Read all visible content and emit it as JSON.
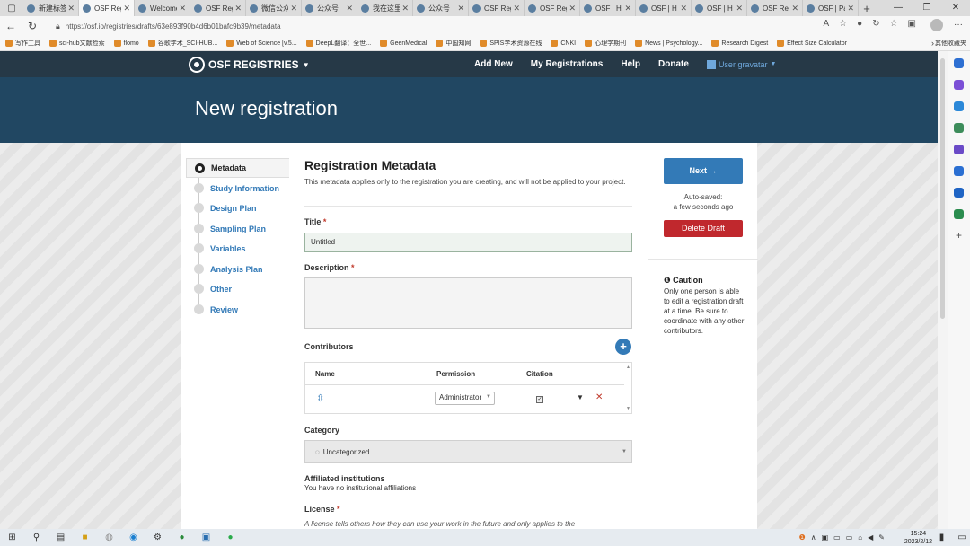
{
  "browser": {
    "tabs": [
      "新建标签",
      "OSF Reg",
      "Welcome",
      "OSF Reg",
      "微信公众",
      "公众号",
      "我在这里",
      "公众号",
      "OSF Reg",
      "OSF Reg",
      "OSF | H",
      "OSF | H",
      "OSF | H",
      "OSF Reg",
      "OSF | Pa"
    ],
    "active_tab_index": 1,
    "url": "https://osf.io/registries/drafts/63e893f90b4d6b01bafc9b39/metadata",
    "bookmarks": [
      "写作工具",
      "sci-hub文献检索",
      "flomo",
      "谷歌学术_SCI-HUB...",
      "Web of Science [v.5...",
      "DeepL翻译：全世...",
      "GeenMedical",
      "中国知网",
      "SPIS学术资源在线",
      "CNKI",
      "心理学期刊",
      "News | Psychology...",
      "Research Digest",
      "Effect Size Calculator"
    ],
    "other_bookmarks": "其他收藏夹"
  },
  "osf_nav": {
    "brand": "OSF REGISTRIES",
    "links": [
      "Add New",
      "My Registrations",
      "Help",
      "Donate"
    ],
    "user": "User gravatar"
  },
  "hero": {
    "title": "New registration"
  },
  "steps": [
    {
      "label": "Metadata",
      "active": true
    },
    {
      "label": "Study Information",
      "active": false
    },
    {
      "label": "Design Plan",
      "active": false
    },
    {
      "label": "Sampling Plan",
      "active": false
    },
    {
      "label": "Variables",
      "active": false
    },
    {
      "label": "Analysis Plan",
      "active": false
    },
    {
      "label": "Other",
      "active": false
    },
    {
      "label": "Review",
      "active": false
    }
  ],
  "form": {
    "heading": "Registration Metadata",
    "hint": "This metadata applies only to the registration you are creating, and will not be applied to your project.",
    "title_label": "Title",
    "title_value": "Untitled",
    "description_label": "Description",
    "contributors_label": "Contributors",
    "columns": [
      "Name",
      "Permission",
      "Citation"
    ],
    "contributor_permission": "Administrator",
    "category_label": "Category",
    "category_value": "Uncategorized",
    "affiliated_label": "Affiliated institutions",
    "affiliated_text": "You have no institutional affiliations",
    "license_label": "License",
    "license_text": "A license tells others how they can use your work in the future and only applies to the"
  },
  "sidebar_right": {
    "next_label": "Next →",
    "autosaved_line1": "Auto-saved:",
    "autosaved_line2": "a few seconds ago",
    "delete_label": "Delete Draft",
    "caution_title": "Caution",
    "caution_text": "Only one person is able to edit a registration draft at a time. Be sure to coordinate with any other contributors."
  },
  "taskbar": {
    "time": "15:24",
    "date": "2023/2/12"
  },
  "colors": {
    "nav_bg": "#263947",
    "hero_bg": "#214762",
    "primary": "#337ab7",
    "danger": "#c0282d"
  }
}
